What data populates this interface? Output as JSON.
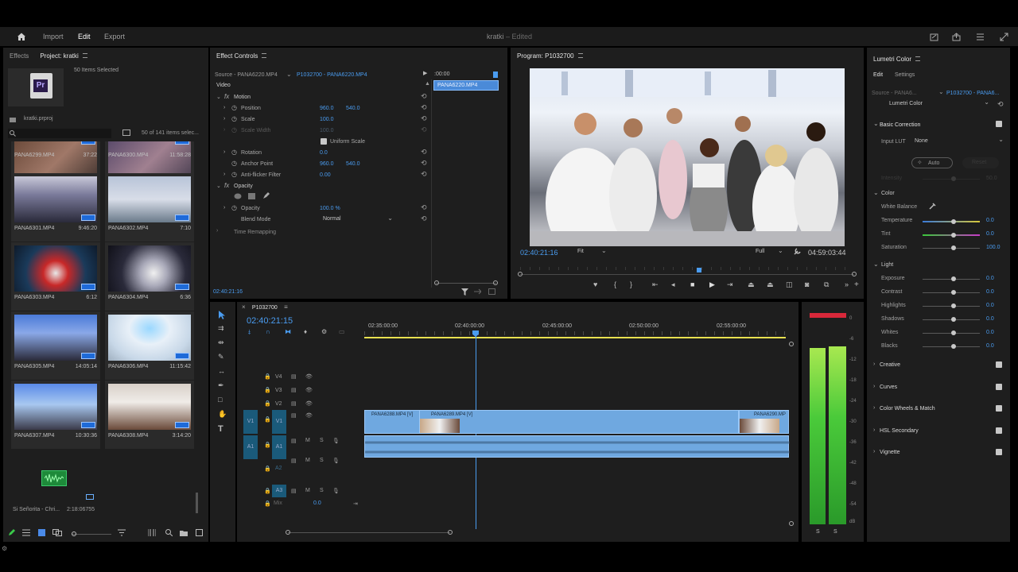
{
  "header": {
    "home_icon": "home-icon",
    "nav": [
      "Import",
      "Edit",
      "Export"
    ],
    "active_nav": "Edit",
    "project_title": "kratki",
    "edited_status": "Edited"
  },
  "project_panel": {
    "tabs": [
      "Effects",
      "Project: kratki"
    ],
    "items_selected": "50 Items Selected",
    "project_file": "kratki.prproj",
    "count": "50 of 141 items selec...",
    "clips": [
      {
        "name": "PANA6299.MP4",
        "dur": "37:22"
      },
      {
        "name": "PANA6300.MP4",
        "dur": "11:58:28"
      },
      {
        "name": "PANA6301.MP4",
        "dur": "9:46:20"
      },
      {
        "name": "PANA6302.MP4",
        "dur": "7:10"
      },
      {
        "name": "PANA6303.MP4",
        "dur": "6:12"
      },
      {
        "name": "PANA6304.MP4",
        "dur": "6:36"
      },
      {
        "name": "PANA6305.MP4",
        "dur": "14:05:14"
      },
      {
        "name": "PANA6306.MP4",
        "dur": "11:15:42"
      },
      {
        "name": "PANA6307.MP4",
        "dur": "10:30:36"
      },
      {
        "name": "PANA6308.MP4",
        "dur": "3:14:20"
      }
    ],
    "audio_clip_name": "Si Señorita - Chri...",
    "audio_clip_dur": "2:18:06755"
  },
  "effect_controls": {
    "tab": "Effect Controls",
    "source": "Source - PANA6220.MP4",
    "sequence_clip": "P1032700 - PANA6220.MP4",
    "timecode_top": ":00:00",
    "clip_label": "PANA6220.MP4",
    "video_label": "Video",
    "motion": "Motion",
    "position_label": "Position",
    "position_x": "960.0",
    "position_y": "540.0",
    "scale_label": "Scale",
    "scale_val": "100.0",
    "scale_width_label": "Scale Width",
    "scale_width_val": "100.0",
    "uniform_scale": "Uniform Scale",
    "rotation_label": "Rotation",
    "rotation_val": "0.0",
    "anchor_label": "Anchor Point",
    "anchor_x": "960.0",
    "anchor_y": "540.0",
    "antiflicker_label": "Anti-flicker Filter",
    "antiflicker_val": "0.00",
    "opacity_group": "Opacity",
    "opacity_label": "Opacity",
    "opacity_val": "100.0 %",
    "blend_label": "Blend Mode",
    "blend_val": "Normal",
    "time_remap": "Time Remapping",
    "bottom_timecode": "02:40:21:16"
  },
  "program": {
    "tab": "Program: P1032700",
    "timecode": "02:40:21:16",
    "fit": "Fit",
    "quality": "Full",
    "duration": "04:59:03:44"
  },
  "timeline": {
    "sequence_name": "P1032700",
    "timecode": "02:40:21:15",
    "ruler": [
      "02:35:00:00",
      "02:40:00:00",
      "02:45:00:00",
      "02:50:00:00",
      "02:55:00:00"
    ],
    "video_tracks": [
      "V4",
      "V3",
      "V2",
      "V1"
    ],
    "audio_tracks": [
      "A1",
      "A2",
      "A3"
    ],
    "mix_label": "Mix",
    "mix_val": "0.0",
    "clips": [
      "PANA6288.MP4 [V]",
      "PANA6289.MP4 [V]",
      "PANA6290.MP"
    ]
  },
  "meter": {
    "labels": [
      "0",
      "-6",
      "-12",
      "-18",
      "-24",
      "-30",
      "-36",
      "-42",
      "-48",
      "-54",
      "dB"
    ],
    "sr": [
      "S",
      "S"
    ]
  },
  "lumetri": {
    "tab": "Lumetri Color",
    "subtabs": [
      "Edit",
      "Settings"
    ],
    "source": "Source - PANA6...",
    "sequence": "P1032700 - PANA6...",
    "effect": "Lumetri Color",
    "basic": "Basic Correction",
    "input_lut_label": "Input LUT",
    "input_lut_val": "None",
    "auto": "Auto",
    "reset": "Reset",
    "intensity_label": "Intensity",
    "intensity_val": "50.0",
    "color": "Color",
    "wb": "White Balance",
    "temp_label": "Temperature",
    "temp_val": "0.0",
    "tint_label": "Tint",
    "tint_val": "0.0",
    "sat_label": "Saturation",
    "sat_val": "100.0",
    "light": "Light",
    "light_params": [
      {
        "label": "Exposure",
        "val": "0.0"
      },
      {
        "label": "Contrast",
        "val": "0.0"
      },
      {
        "label": "Highlights",
        "val": "0.0"
      },
      {
        "label": "Shadows",
        "val": "0.0"
      },
      {
        "label": "Whites",
        "val": "0.0"
      },
      {
        "label": "Blacks",
        "val": "0.0"
      }
    ],
    "sections": [
      "Creative",
      "Curves",
      "Color Wheels & Match",
      "HSL Secondary",
      "Vignette"
    ]
  }
}
